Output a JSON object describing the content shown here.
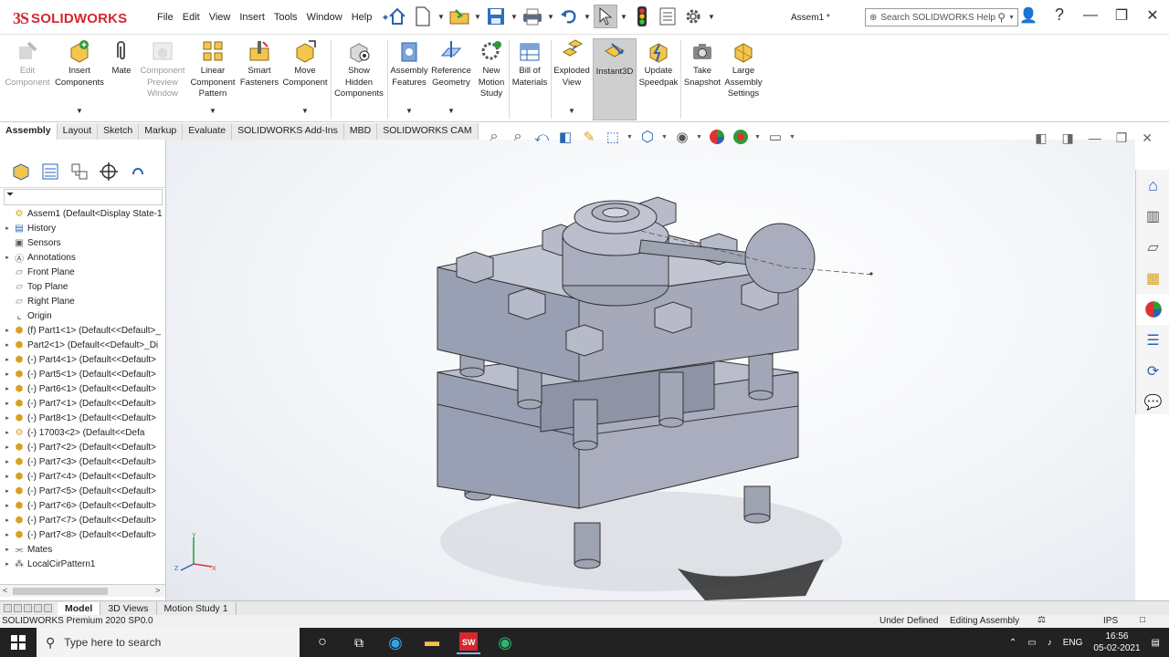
{
  "app": {
    "name": "SOLIDWORKS",
    "document_title": "Assem1 *"
  },
  "menu": [
    "File",
    "Edit",
    "View",
    "Insert",
    "Tools",
    "Window",
    "Help"
  ],
  "search": {
    "placeholder": "Search SOLIDWORKS Help"
  },
  "ribbon": [
    {
      "id": "edit-component",
      "label": "Edit\nComponent",
      "disabled": true,
      "icon": "edit-component-icon"
    },
    {
      "id": "insert-components",
      "label": "Insert\nComponents",
      "icon": "insert-components-icon"
    },
    {
      "id": "mate",
      "label": "Mate",
      "icon": "mate-paperclip-icon"
    },
    {
      "id": "component-preview",
      "label": "Component\nPreview\nWindow",
      "disabled": true,
      "icon": "component-preview-icon"
    },
    {
      "id": "linear-pattern",
      "label": "Linear\nComponent\nPattern",
      "icon": "linear-pattern-icon"
    },
    {
      "id": "smart-fasteners",
      "label": "Smart\nFasteners",
      "icon": "smart-fasteners-icon"
    },
    {
      "id": "move-component",
      "label": "Move\nComponent",
      "icon": "move-component-icon"
    },
    {
      "id": "show-hidden",
      "label": "Show\nHidden\nComponents",
      "icon": "show-hidden-icon"
    },
    {
      "id": "assembly-features",
      "label": "Assembly\nFeatures",
      "icon": "assembly-features-icon"
    },
    {
      "id": "reference-geometry",
      "label": "Reference\nGeometry",
      "icon": "reference-geometry-icon"
    },
    {
      "id": "new-motion-study",
      "label": "New\nMotion\nStudy",
      "icon": "motion-study-icon"
    },
    {
      "id": "bill-of-materials",
      "label": "Bill of\nMaterials",
      "icon": "bom-icon"
    },
    {
      "id": "exploded-view",
      "label": "Exploded\nView",
      "icon": "exploded-view-icon"
    },
    {
      "id": "instant3d",
      "label": "Instant3D",
      "active": true,
      "icon": "instant3d-icon"
    },
    {
      "id": "update-speedpak",
      "label": "Update\nSpeedpak",
      "icon": "speedpak-icon"
    },
    {
      "id": "take-snapshot",
      "label": "Take\nSnapshot",
      "icon": "camera-icon"
    },
    {
      "id": "large-assembly",
      "label": "Large\nAssembly\nSettings",
      "icon": "large-assembly-icon"
    }
  ],
  "command_tabs": [
    {
      "label": "Assembly",
      "active": true
    },
    {
      "label": "Layout"
    },
    {
      "label": "Sketch"
    },
    {
      "label": "Markup"
    },
    {
      "label": "Evaluate"
    },
    {
      "label": "SOLIDWORKS Add-Ins"
    },
    {
      "label": "MBD"
    },
    {
      "label": "SOLIDWORKS CAM"
    }
  ],
  "tree": [
    {
      "label": "Assem1  (Default<Display State-1",
      "icon": "assembly-icon",
      "expand": "",
      "root": true
    },
    {
      "label": "History",
      "icon": "history-icon",
      "expand": "▸"
    },
    {
      "label": "Sensors",
      "icon": "sensors-icon",
      "expand": ""
    },
    {
      "label": "Annotations",
      "icon": "annotations-icon",
      "expand": "▸"
    },
    {
      "label": "Front Plane",
      "icon": "plane-icon",
      "expand": ""
    },
    {
      "label": "Top Plane",
      "icon": "plane-icon",
      "expand": ""
    },
    {
      "label": "Right Plane",
      "icon": "plane-icon",
      "expand": ""
    },
    {
      "label": "Origin",
      "icon": "origin-icon",
      "expand": ""
    },
    {
      "label": "(f) Part1<1> (Default<<Default>_",
      "icon": "part-icon",
      "expand": "▸"
    },
    {
      "label": "Part2<1> (Default<<Default>_Di",
      "icon": "part-icon",
      "expand": "▸"
    },
    {
      "label": "(-) Part4<1> (Default<<Default>",
      "icon": "part-icon",
      "expand": "▸"
    },
    {
      "label": "(-) Part5<1> (Default<<Default>",
      "icon": "part-icon",
      "expand": "▸"
    },
    {
      "label": "(-) Part6<1> (Default<<Default>",
      "icon": "part-icon",
      "expand": "▸"
    },
    {
      "label": "(-) Part7<1> (Default<<Default>",
      "icon": "part-icon",
      "expand": "▸"
    },
    {
      "label": "(-) Part8<1> (Default<<Default>",
      "icon": "part-icon",
      "expand": "▸"
    },
    {
      "label": "(-) 17003<2> (Default<<Defa",
      "icon": "subassembly-icon",
      "expand": "▸"
    },
    {
      "label": "(-) Part7<2> (Default<<Default>",
      "icon": "part-icon",
      "expand": "▸"
    },
    {
      "label": "(-) Part7<3> (Default<<Default>",
      "icon": "part-icon",
      "expand": "▸"
    },
    {
      "label": "(-) Part7<4> (Default<<Default>",
      "icon": "part-icon",
      "expand": "▸"
    },
    {
      "label": "(-) Part7<5> (Default<<Default>",
      "icon": "part-icon",
      "expand": "▸"
    },
    {
      "label": "(-) Part7<6> (Default<<Default>",
      "icon": "part-icon",
      "expand": "▸"
    },
    {
      "label": "(-) Part7<7> (Default<<Default>",
      "icon": "part-icon",
      "expand": "▸"
    },
    {
      "label": "(-) Part7<8> (Default<<Default>",
      "icon": "part-icon",
      "expand": "▸"
    },
    {
      "label": "Mates",
      "icon": "mates-icon",
      "expand": "▸"
    },
    {
      "label": "LocalCirPattern1",
      "icon": "pattern-icon",
      "expand": "▸"
    }
  ],
  "bottom_tabs": [
    {
      "label": "Model",
      "active": true
    },
    {
      "label": "3D Views"
    },
    {
      "label": "Motion Study 1"
    }
  ],
  "status": {
    "product": "SOLIDWORKS Premium 2020 SP0.0",
    "definition": "Under Defined",
    "mode": "Editing Assembly",
    "units": "IPS",
    "custom_symbol": "⚖",
    "chat_symbol": "□"
  },
  "triad": {
    "x": "X",
    "y": "Y",
    "z": "Z"
  },
  "taskbar": {
    "search_placeholder": "Type here to search",
    "language": "ENG",
    "time": "16:56",
    "date": "05-02-2021"
  },
  "colors": {
    "brand": "#d7262e",
    "part_fill": "#a9adbd",
    "accent_blue": "#1d6fd1"
  }
}
